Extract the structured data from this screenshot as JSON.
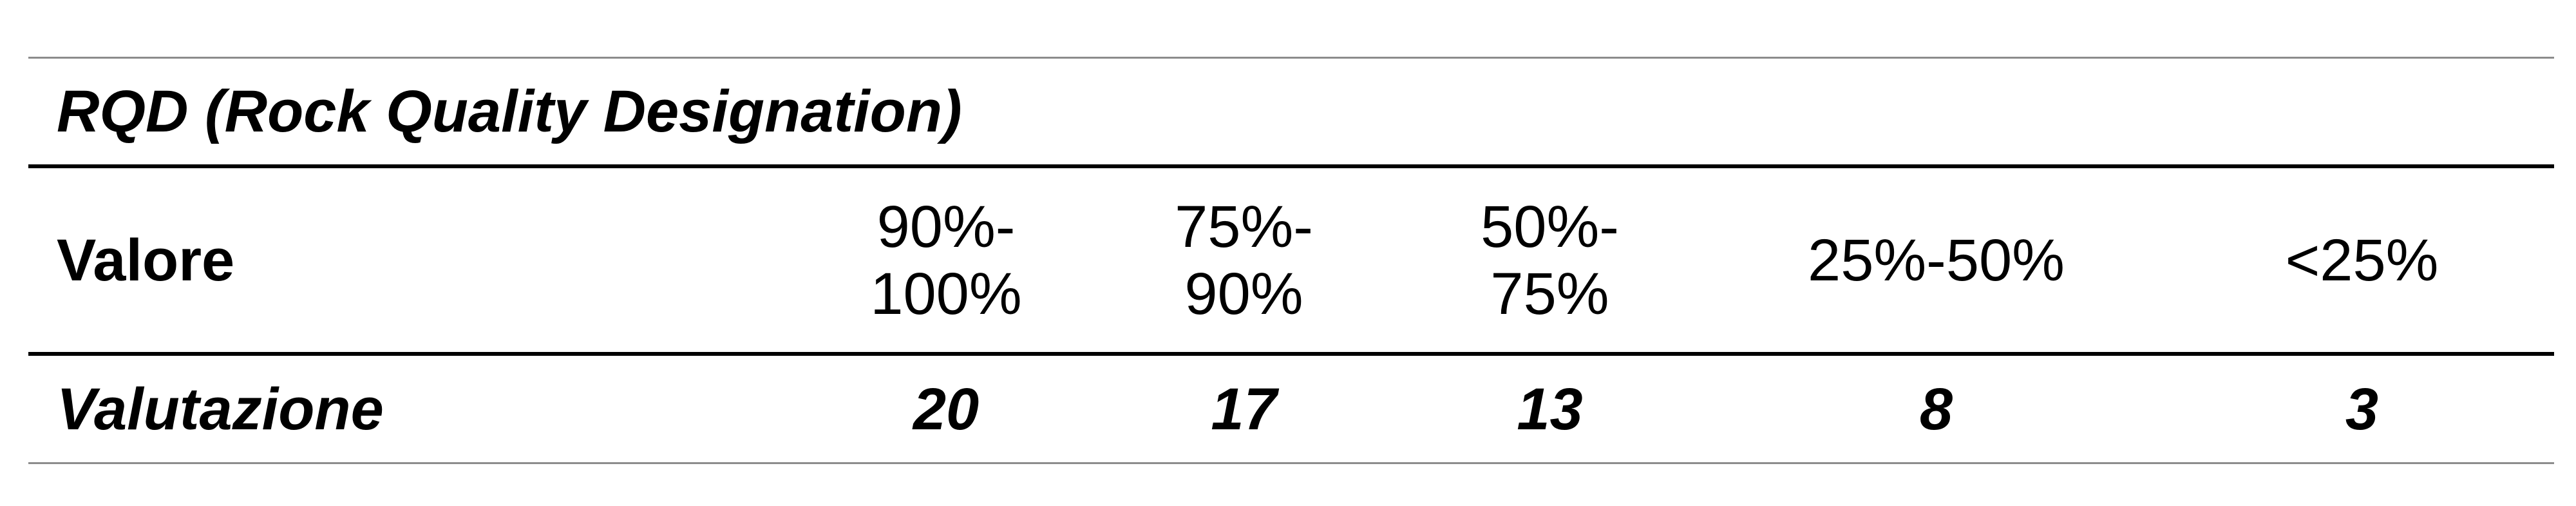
{
  "table": {
    "title": "RQD (Rock Quality Designation)",
    "row_labels": {
      "values": "Valore",
      "ratings": "Valutazione"
    },
    "columns": [
      {
        "range_lines": [
          "90%-",
          "100%"
        ],
        "rating": "20"
      },
      {
        "range_lines": [
          "75%-",
          "90%"
        ],
        "rating": "17"
      },
      {
        "range_lines": [
          "50%-",
          "75%"
        ],
        "rating": "13"
      },
      {
        "range_lines": [
          "25%-50%"
        ],
        "rating": "8"
      },
      {
        "range_lines": [
          "<25%"
        ],
        "rating": "3"
      }
    ]
  }
}
